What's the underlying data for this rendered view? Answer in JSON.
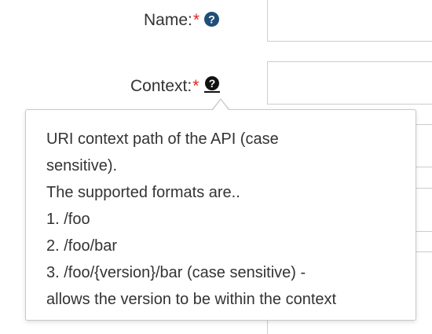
{
  "form": {
    "name": {
      "label": "Name:",
      "required_mark": "*",
      "help_icon": "question-circle-icon",
      "value": ""
    },
    "context": {
      "label": "Context:",
      "required_mark": "*",
      "help_icon": "question-circle-icon",
      "value": ""
    }
  },
  "popover": {
    "lines": [
      "URI context path of the API (case",
      "sensitive).",
      "The supported formats are..",
      "1. /foo",
      "2. /foo/bar",
      "3. /foo/{version}/bar (case sensitive) -",
      "allows the version to be within the context"
    ]
  },
  "colors": {
    "required": "#e2231a",
    "help_icon": "#1f4e79",
    "text": "#333333",
    "border": "#cccccc"
  }
}
